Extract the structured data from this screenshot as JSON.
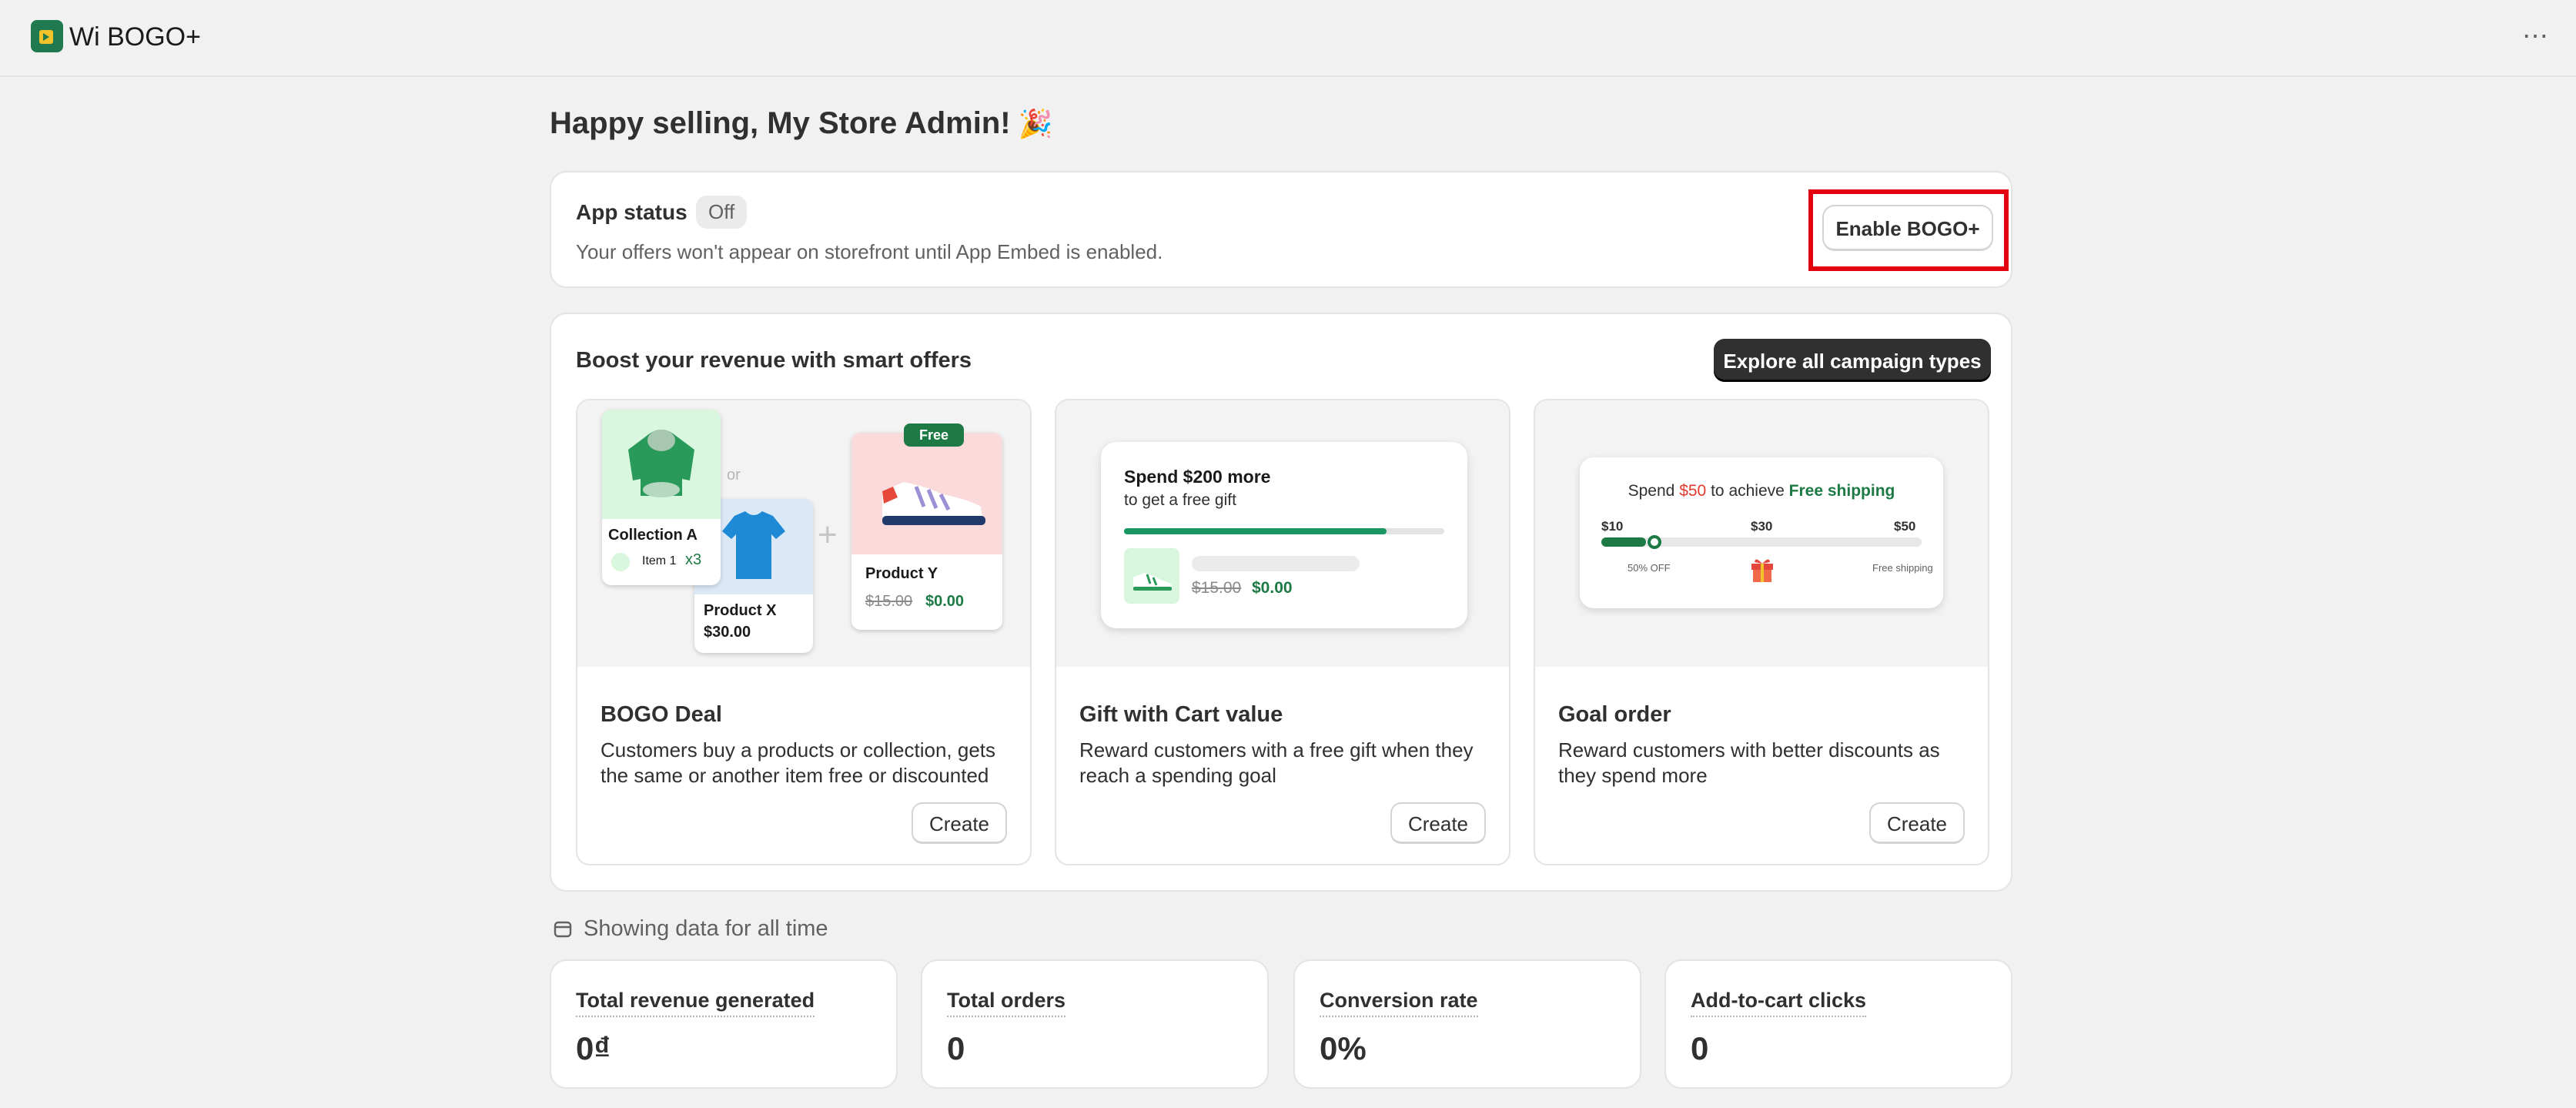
{
  "app": {
    "name": "Wi BOGO+",
    "menu_icon": "more-horizontal-icon"
  },
  "greeting": {
    "text": "Happy selling, My Store Admin!",
    "emoji": "🎉"
  },
  "app_status": {
    "label": "App status",
    "badge": "Off",
    "description": "Your offers won't appear on storefront until App Embed is enabled.",
    "enable_button": "Enable BOGO+",
    "highlight_color": "#e3000f"
  },
  "offers": {
    "title": "Boost your revenue with smart offers",
    "explore_button": "Explore all campaign types",
    "items": [
      {
        "title": "BOGO Deal",
        "description": "Customers buy a products or collection, gets the same or another item free or discounted",
        "create_label": "Create",
        "illustration": {
          "collection_name": "Collection A",
          "collection_item": "Item 1",
          "collection_qty": "x3",
          "or_text": "or",
          "plus_text": "+",
          "product_x_name": "Product X",
          "product_x_price": "$30.00",
          "free_tag": "Free",
          "product_y_name": "Product Y",
          "product_y_old_price": "$15.00",
          "product_y_new_price": "$0.00"
        }
      },
      {
        "title": "Gift with Cart value",
        "description": "Reward customers with a free gift when they reach a spending goal",
        "create_label": "Create",
        "illustration": {
          "line1": "Spend $200 more",
          "line2": "to get a free gift",
          "progress": 0.82,
          "old_price": "$15.00",
          "new_price": "$0.00"
        }
      },
      {
        "title": "Goal order",
        "description": "Reward customers with better discounts as they spend more",
        "create_label": "Create",
        "illustration": {
          "head_prefix": "Spend",
          "head_amount": "$50",
          "head_middle": "to achieve",
          "head_reward": "Free shipping",
          "ticks": [
            "$10",
            "$30",
            "$50"
          ],
          "progress": 0.14,
          "left_label": "50% OFF",
          "right_label": "Free shipping"
        }
      }
    ]
  },
  "data_range": {
    "icon": "calendar-icon",
    "text": "Showing data for all time"
  },
  "stats": [
    {
      "label": "Total revenue generated",
      "value": "0₫"
    },
    {
      "label": "Total orders",
      "value": "0"
    },
    {
      "label": "Conversion rate",
      "value": "0%"
    },
    {
      "label": "Add-to-cart clicks",
      "value": "0"
    }
  ],
  "colors": {
    "brand_green": "#1d7a45",
    "primary_dark": "#303030",
    "page_bg": "#f1f1f1"
  }
}
